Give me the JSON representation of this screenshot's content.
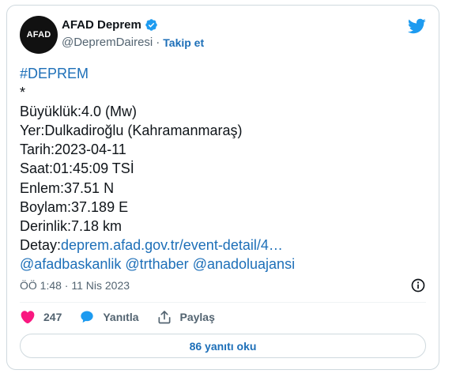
{
  "tweet": {
    "author": {
      "name": "AFAD Deprem",
      "handle": "@DepremDairesi",
      "follow_label": "Takip et",
      "avatar_text": "AFAD",
      "verified_icon": "verified-badge-icon"
    },
    "hashtag": "#DEPREM",
    "asterisk": "*",
    "lines": {
      "magnitude": "Büyüklük:4.0 (Mw)",
      "location": "Yer:Dulkadiroğlu (Kahramanmaraş)",
      "date": "Tarih:2023-04-11",
      "time": "Saat:01:45:09 TSİ",
      "latitude": "Enlem:37.51 N",
      "longitude": "Boylam:37.189 E",
      "depth": "Derinlik:7.18 km",
      "detail_label": "Detay:",
      "detail_link": "deprem.afad.gov.tr/event-detail/4…"
    },
    "mentions": [
      "@afadbaskanlik",
      "@trthaber",
      "@anadoluajansi"
    ],
    "timestamp": "ÖÖ 1:48 · 11 Nis 2023",
    "likes": "247",
    "reply_label": "Yanıtla",
    "share_label": "Paylaş",
    "read_replies": "86 yanıtı oku"
  },
  "colors": {
    "link": "#1d6fb8",
    "like": "#f91880",
    "twitter": "#1d9bf0",
    "muted": "#536471"
  }
}
